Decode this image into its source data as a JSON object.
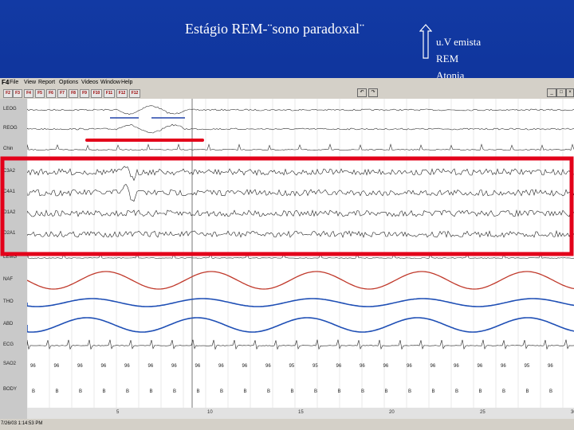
{
  "slide": {
    "title": "Estágio REM-¨sono paradoxal¨",
    "notes": [
      "u.V emista",
      "REM",
      "Atonia"
    ]
  },
  "app": {
    "icon_label": "F4",
    "menu": [
      "File",
      "View",
      "Report",
      "Options",
      "Videos",
      "Window",
      "Help"
    ],
    "toolbar_buttons": [
      "F2",
      "F3",
      "F4",
      "F5",
      "F6",
      "F7",
      "F8",
      "F9",
      "F10",
      "F11",
      "F12",
      "F12"
    ]
  },
  "channels": [
    "LEOG",
    "REOG",
    "Chin",
    "C3A2",
    "C4A1",
    "O1A2",
    "O2A1",
    "LEMG",
    "NAF",
    "THO",
    "ABD",
    "ECG",
    "SAO2",
    "BODY"
  ],
  "spo2_values": [
    "96",
    "96",
    "96",
    "96",
    "96",
    "96",
    "96",
    "96",
    "96",
    "96",
    "96",
    "95",
    "95",
    "96",
    "96",
    "96",
    "96",
    "96",
    "96",
    "96",
    "96",
    "95",
    "96"
  ],
  "body_values": [
    "B",
    "B",
    "B",
    "B",
    "B",
    "B",
    "B",
    "B",
    "B",
    "B",
    "B",
    "B",
    "B",
    "B",
    "B",
    "B",
    "B",
    "B",
    "B",
    "B",
    "B",
    "B",
    "B"
  ],
  "time_ticks": [
    "5",
    "10",
    "15",
    "20",
    "25",
    "30"
  ],
  "status": {
    "clock": "7/26/03  1:14:53 PM"
  },
  "colors": {
    "slide_bg": "#0a2a8c",
    "highlight": "#e3001a",
    "neg_signal": "#c0392b",
    "resp_signal": "#1f4fb5"
  }
}
